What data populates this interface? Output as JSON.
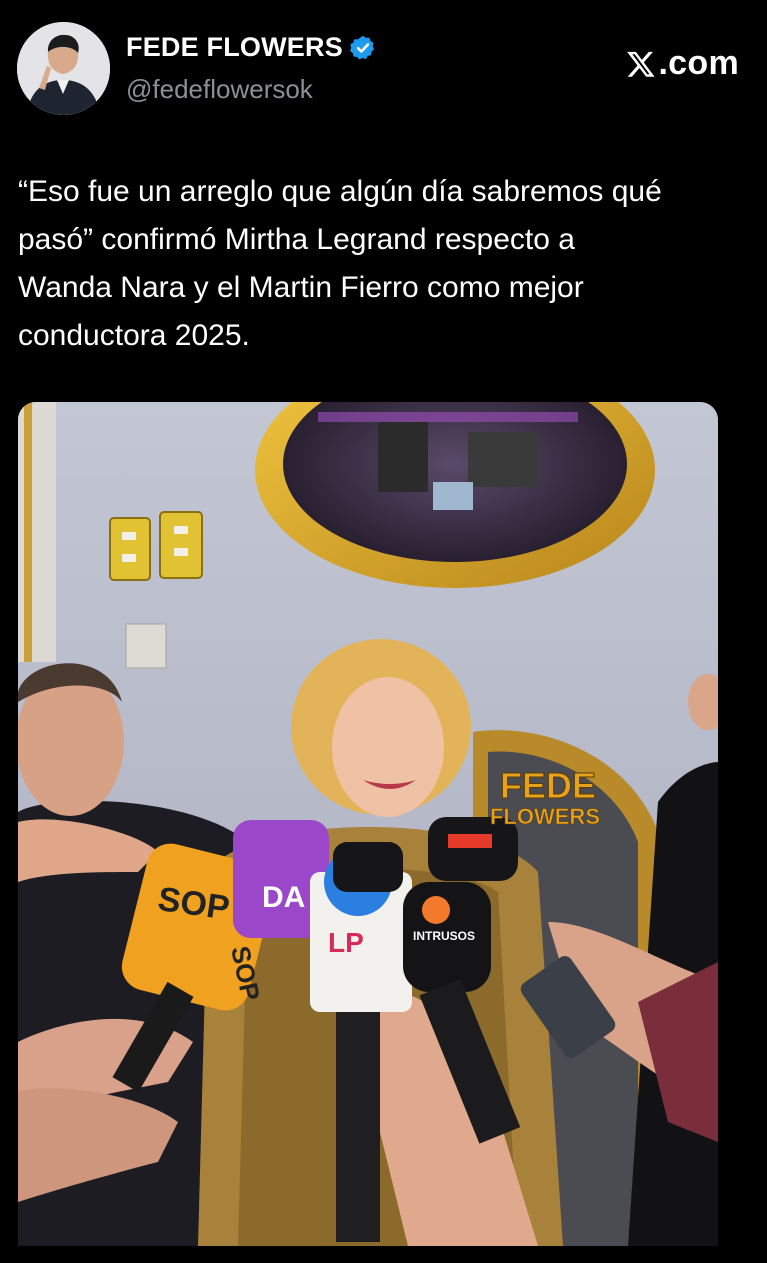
{
  "post": {
    "author": {
      "display_name": "FEDE FLOWERS",
      "handle": "@fedeflowersok",
      "verified": true,
      "avatar_icon": "profile-photo"
    },
    "brand": {
      "label": ".com",
      "icon": "x-logo-icon"
    },
    "text": "“Eso fue un arreglo que algún día sabremos qué\npasó” confirmó Mirtha Legrand  respecto a\nWanda Nara y el Martin Fierro como mejor\nconductora 2025.",
    "media": {
      "watermark_line1": "FEDE",
      "watermark_line2": "FLOWERS",
      "mic_labels": [
        "SOP",
        "SOP",
        "DA",
        "LP",
        "INTRUSOS"
      ]
    }
  },
  "colors": {
    "background": "#000000",
    "text": "#ffffff",
    "handle": "#8b9096",
    "verified": "#1d9bf0",
    "watermark": "#e6a21c"
  }
}
